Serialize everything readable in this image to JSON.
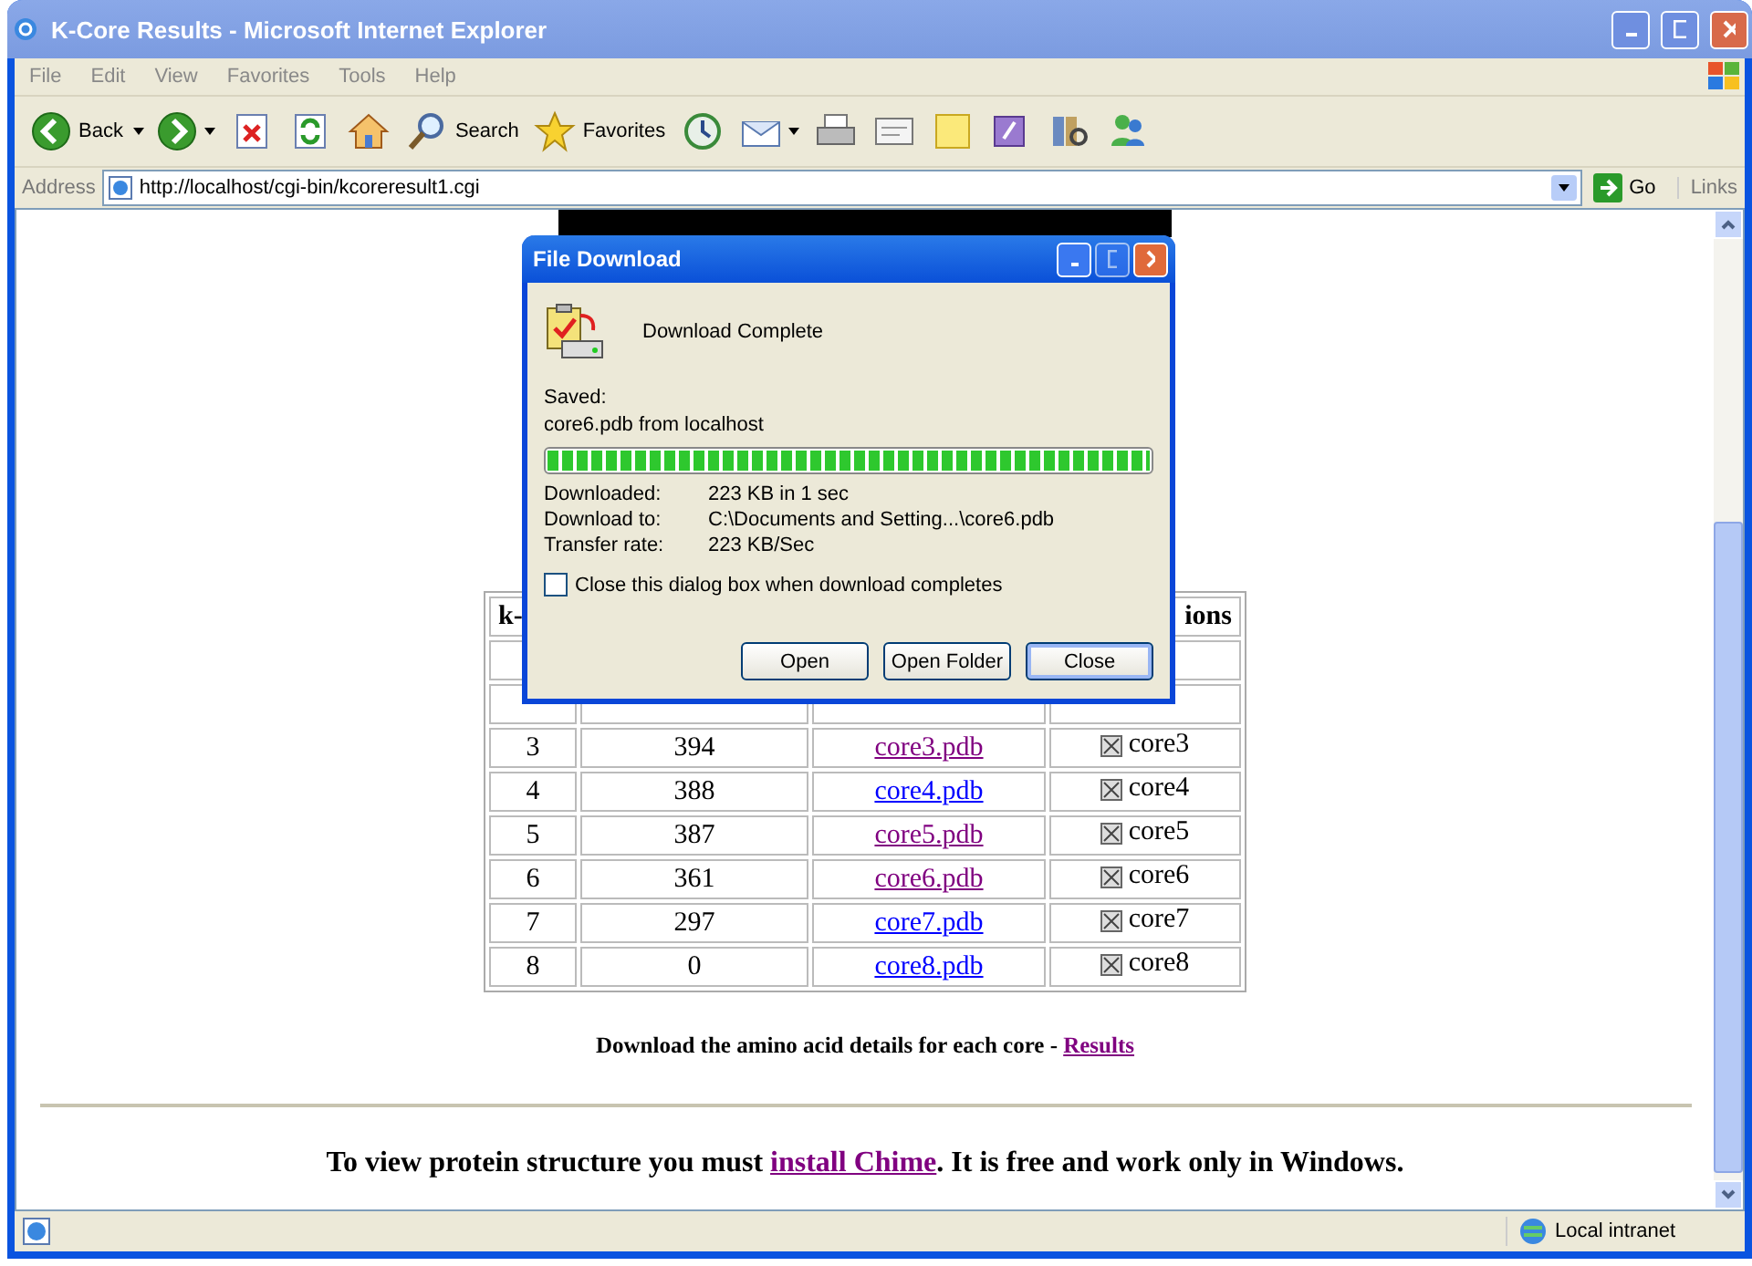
{
  "window": {
    "title": "K-Core Results - Microsoft Internet Explorer"
  },
  "menu": [
    "File",
    "Edit",
    "View",
    "Favorites",
    "Tools",
    "Help"
  ],
  "toolbar": [
    {
      "kind": "back",
      "label": "Back",
      "dropdown": true
    },
    {
      "kind": "forward",
      "dropdown": true
    },
    {
      "kind": "stop"
    },
    {
      "kind": "refresh"
    },
    {
      "kind": "home"
    },
    {
      "kind": "search",
      "label": "Search"
    },
    {
      "kind": "favorites",
      "label": "Favorites"
    },
    {
      "kind": "history"
    },
    {
      "kind": "mail",
      "dropdown": true
    },
    {
      "kind": "print"
    },
    {
      "kind": "edit"
    },
    {
      "kind": "note"
    },
    {
      "kind": "research"
    },
    {
      "kind": "library"
    },
    {
      "kind": "messenger"
    }
  ],
  "address_bar": {
    "label": "Address",
    "url": "http://localhost/cgi-bin/kcoreresult1.cgi",
    "go": "Go",
    "links": "Links"
  },
  "table": {
    "column_1": "k-",
    "column_4": "ions",
    "rows": [
      {
        "k": "3",
        "size": "394",
        "file": "core3.pdb",
        "visited": true,
        "view": "core3"
      },
      {
        "k": "4",
        "size": "388",
        "file": "core4.pdb",
        "visited": false,
        "view": "core4"
      },
      {
        "k": "5",
        "size": "387",
        "file": "core5.pdb",
        "visited": true,
        "view": "core5"
      },
      {
        "k": "6",
        "size": "361",
        "file": "core6.pdb",
        "visited": true,
        "view": "core6"
      },
      {
        "k": "7",
        "size": "297",
        "file": "core7.pdb",
        "visited": false,
        "view": "core7"
      },
      {
        "k": "8",
        "size": "0",
        "file": "core8.pdb",
        "visited": false,
        "view": "core8"
      }
    ]
  },
  "download_note": {
    "text": "Download the amino acid details for each core - ",
    "link": "Results",
    "visited": true
  },
  "chime_note": {
    "before": "To view protein structure you must ",
    "link": "install Chime",
    "after": ". It is free and work only in Windows.",
    "visited": true
  },
  "dialog": {
    "title": "File Download",
    "message": "Download Complete",
    "saved_label": "Saved:",
    "source": "core6.pdb from localhost",
    "level": 1,
    "details": [
      {
        "label": "Downloaded:",
        "value": "223 KB in 1 sec"
      },
      {
        "label": "Download to:",
        "value": "C:\\Documents and Setting...\\core6.pdb"
      },
      {
        "label": "Transfer rate:",
        "value": "223 KB/Sec"
      }
    ],
    "checkbox": {
      "label": "Close this dialog box when download completes",
      "checked": false
    },
    "buttons": [
      {
        "label": "Open",
        "focused": false
      },
      {
        "label": "Open Folder",
        "focused": false
      },
      {
        "label": "Close",
        "focused": true
      }
    ]
  },
  "status_bar": {
    "zone": "Local intranet"
  }
}
